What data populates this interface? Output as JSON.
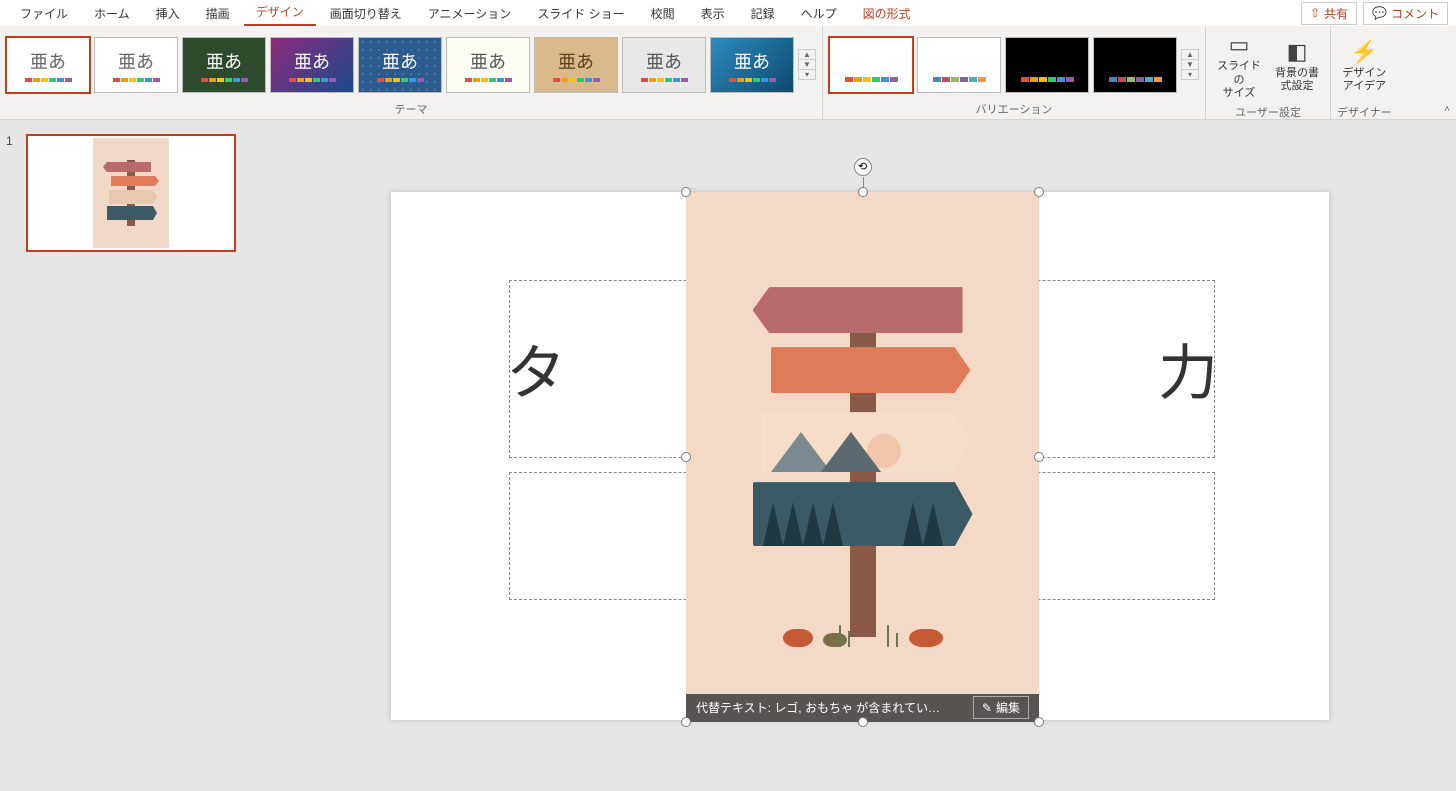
{
  "menu": {
    "tabs": [
      "ファイル",
      "ホーム",
      "挿入",
      "描画",
      "デザイン",
      "画面切り替え",
      "アニメーション",
      "スライド ショー",
      "校閲",
      "表示",
      "記録",
      "ヘルプ",
      "図の形式"
    ],
    "active_index": 4,
    "context_index": 12,
    "share": "共有",
    "comment": "コメント"
  },
  "ribbon": {
    "themes_label": "テーマ",
    "variations_label": "バリエーション",
    "user_label": "ユーザー設定",
    "designer_label": "デザイナー",
    "theme_glyph": "亜あ",
    "slide_size": "スライドの\nサイズ",
    "bg_format": "背景の書\n式設定",
    "design_ideas": "デザイン\nアイデア"
  },
  "thumb": {
    "slide_number": "1"
  },
  "slide": {
    "title_partial_left": "タ",
    "title_partial_right": "力"
  },
  "alt": {
    "text": "代替テキスト: レゴ, おもちゃ が含まれてい…",
    "edit": "編集"
  }
}
